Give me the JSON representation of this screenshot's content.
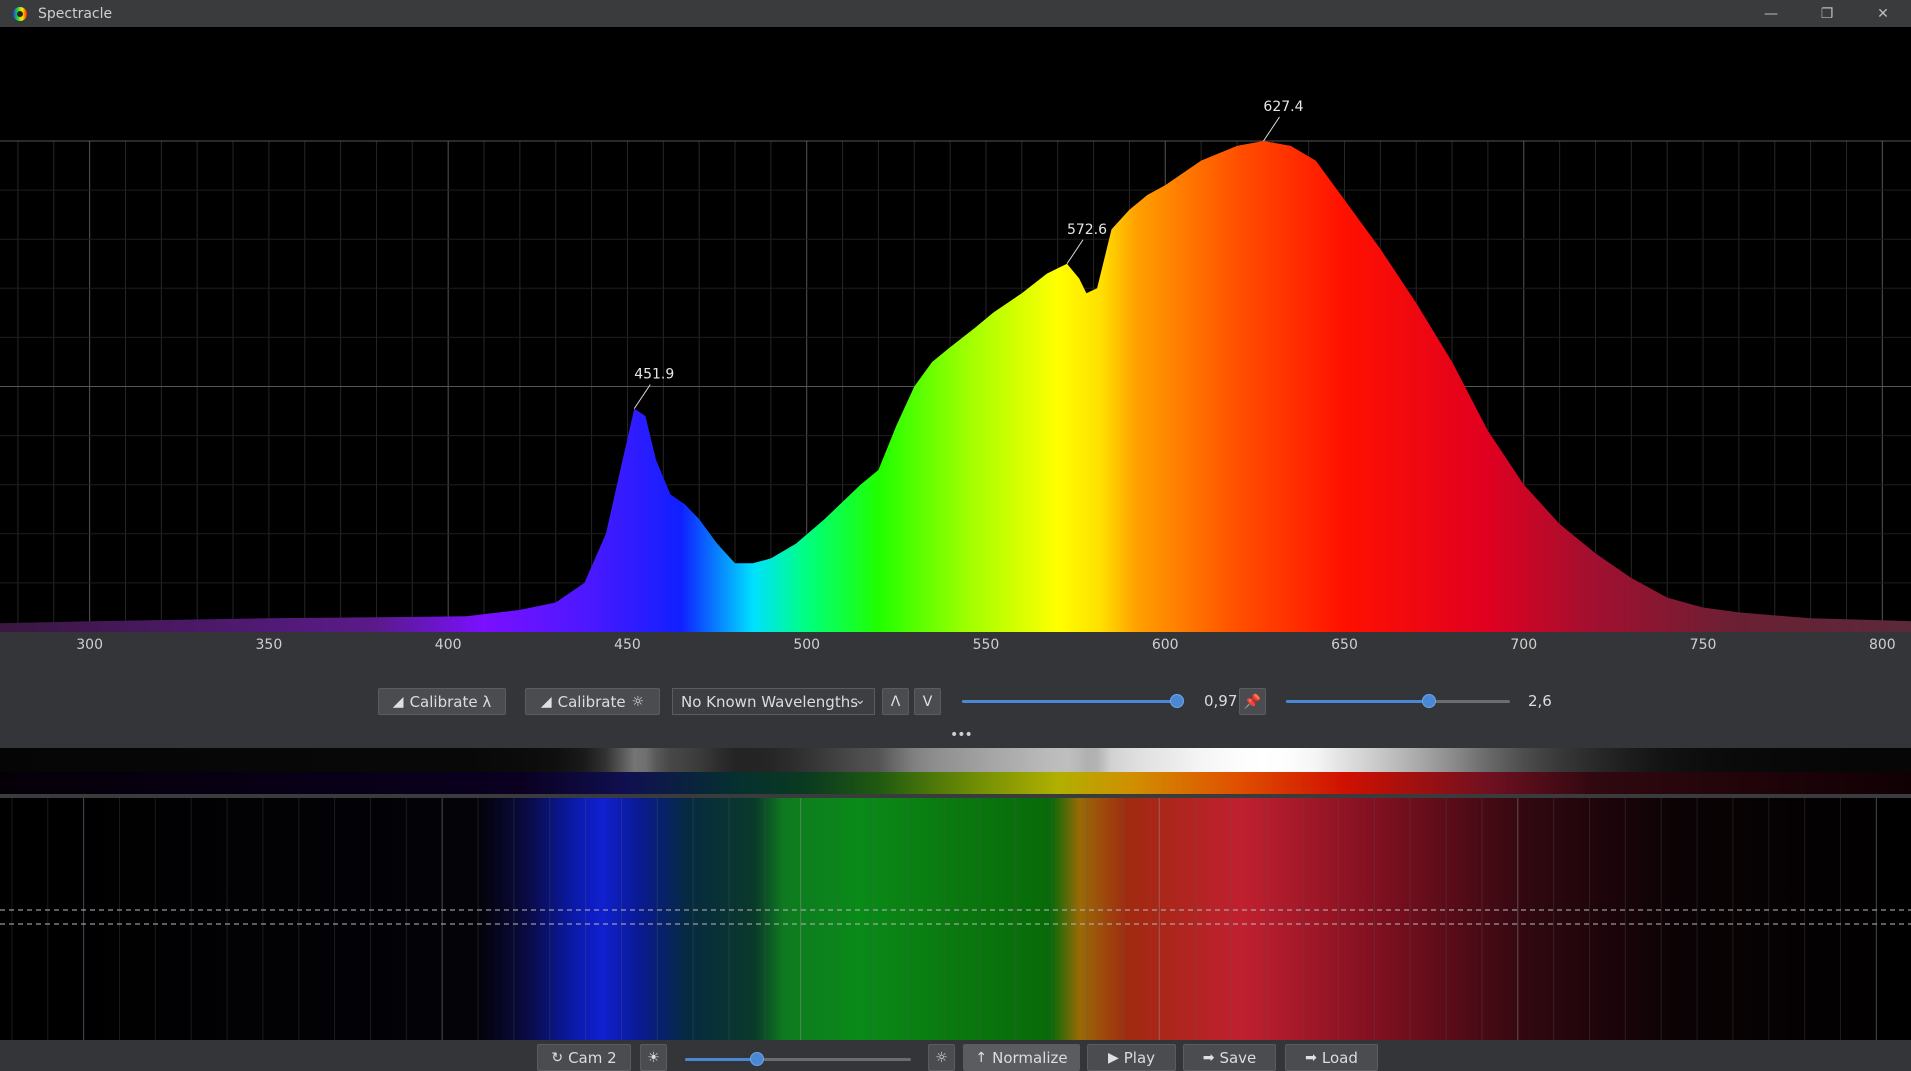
{
  "window": {
    "title": "Spectracle",
    "controls": [
      "minimize",
      "restore",
      "close"
    ]
  },
  "spectrum": {
    "x_axis": {
      "min": 275,
      "max": 808,
      "ticks": [
        300,
        350,
        400,
        450,
        500,
        550,
        600,
        650,
        700,
        750,
        800
      ]
    },
    "peaks": [
      {
        "label": "451.9",
        "wavelength": 451.9,
        "intensity": 0.455
      },
      {
        "label": "572.6",
        "wavelength": 572.6,
        "intensity": 0.75
      },
      {
        "label": "627.4",
        "wavelength": 627.4,
        "intensity": 1.0
      }
    ],
    "curve_points": [
      [
        275,
        0.018
      ],
      [
        300,
        0.022
      ],
      [
        350,
        0.028
      ],
      [
        380,
        0.03
      ],
      [
        405,
        0.032
      ],
      [
        420,
        0.045
      ],
      [
        430,
        0.06
      ],
      [
        438,
        0.1
      ],
      [
        444,
        0.2
      ],
      [
        448,
        0.33
      ],
      [
        451.9,
        0.455
      ],
      [
        455,
        0.44
      ],
      [
        458,
        0.35
      ],
      [
        462,
        0.28
      ],
      [
        466,
        0.26
      ],
      [
        470,
        0.23
      ],
      [
        475,
        0.18
      ],
      [
        480,
        0.14
      ],
      [
        485,
        0.14
      ],
      [
        490,
        0.15
      ],
      [
        497,
        0.18
      ],
      [
        505,
        0.23
      ],
      [
        515,
        0.3
      ],
      [
        520,
        0.33
      ],
      [
        525,
        0.42
      ],
      [
        530,
        0.5
      ],
      [
        535,
        0.55
      ],
      [
        540,
        0.58
      ],
      [
        547,
        0.62
      ],
      [
        552,
        0.65
      ],
      [
        560,
        0.69
      ],
      [
        567,
        0.73
      ],
      [
        572.6,
        0.75
      ],
      [
        576,
        0.72
      ],
      [
        578,
        0.69
      ],
      [
        581,
        0.7
      ],
      [
        585,
        0.82
      ],
      [
        590,
        0.86
      ],
      [
        595,
        0.89
      ],
      [
        600,
        0.91
      ],
      [
        610,
        0.96
      ],
      [
        620,
        0.99
      ],
      [
        627.4,
        1.0
      ],
      [
        635,
        0.99
      ],
      [
        642,
        0.96
      ],
      [
        650,
        0.88
      ],
      [
        660,
        0.78
      ],
      [
        670,
        0.67
      ],
      [
        680,
        0.55
      ],
      [
        690,
        0.41
      ],
      [
        700,
        0.3
      ],
      [
        710,
        0.22
      ],
      [
        720,
        0.16
      ],
      [
        730,
        0.11
      ],
      [
        740,
        0.07
      ],
      [
        750,
        0.05
      ],
      [
        760,
        0.04
      ],
      [
        780,
        0.028
      ],
      [
        800,
        0.024
      ],
      [
        808,
        0.022
      ]
    ]
  },
  "controls": {
    "calibrate_wavelength": "Calibrate λ",
    "calibrate_intensity": "Calibrate",
    "known_wavelengths": "No Known Wavelengths",
    "slider1_value": "0,97",
    "slider1_fraction": 0.97,
    "slider2_value": "2,6",
    "slider2_fraction": 0.64
  },
  "bottom": {
    "camera": "Cam 2",
    "exposure_fraction": 0.32,
    "normalize": "Normalize",
    "play": "Play",
    "save": "Save",
    "load": "Load"
  },
  "colors": {
    "accent": "#4a88d4",
    "panel": "#343538",
    "titlebar": "#3a3b3d"
  }
}
